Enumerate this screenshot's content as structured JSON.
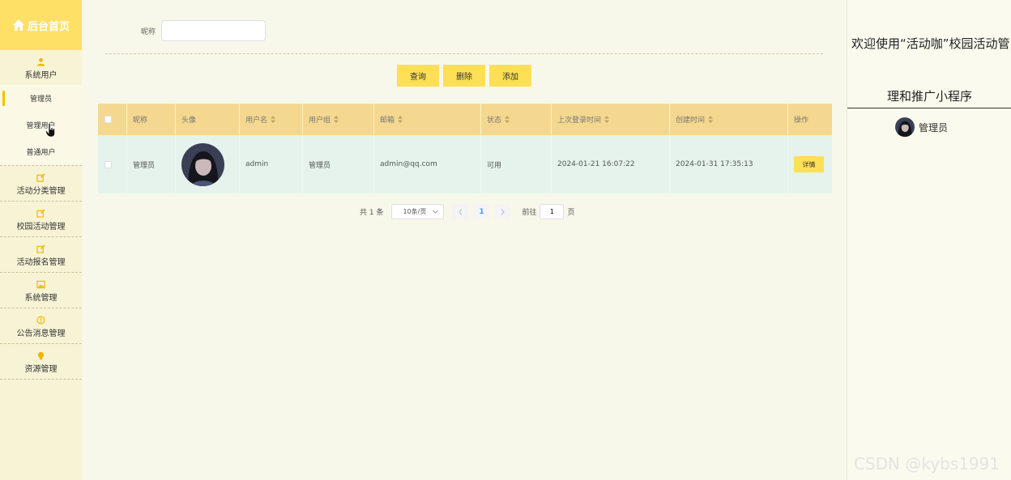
{
  "sidebar": {
    "logo": "后台首页",
    "groups": [
      {
        "label": "系统用户",
        "icon": "user-icon",
        "items": [
          "管理员",
          "管理用户",
          "普通用户"
        ]
      },
      {
        "label": "活动分类管理",
        "icon": "edit-icon"
      },
      {
        "label": "校园活动管理",
        "icon": "edit-icon"
      },
      {
        "label": "活动报名管理",
        "icon": "edit-icon"
      },
      {
        "label": "系统管理",
        "icon": "image-icon"
      },
      {
        "label": "公告消息管理",
        "icon": "info-icon"
      },
      {
        "label": "资源管理",
        "icon": "bulb-icon"
      }
    ],
    "active_item": "管理员"
  },
  "search": {
    "label": "昵称",
    "value": "",
    "placeholder": ""
  },
  "buttons": {
    "query": "查询",
    "delete": "删除",
    "add": "添加"
  },
  "table": {
    "headers": [
      "昵称",
      "头像",
      "用户名",
      "用户组",
      "邮箱",
      "状态",
      "上次登录时间",
      "创建时间",
      "操作"
    ],
    "rows": [
      {
        "nickname": "管理员",
        "username": "admin",
        "group": "管理员",
        "email": "admin@qq.com",
        "status": "可用",
        "last_login": "2024-01-21 16:07:22",
        "created": "2024-01-31 17:35:13",
        "action": "详情"
      }
    ]
  },
  "pagination": {
    "total": "共 1 条",
    "page_size": "10条/页",
    "current_page": "1",
    "goto_label": "前往",
    "goto_value": "1",
    "page_unit": "页"
  },
  "right_panel": {
    "welcome_line1": "欢迎使用“活动咖”校园活动管",
    "welcome_line2": "理和推广小程序",
    "user_name": "管理员"
  },
  "watermark": "CSDN @kybs1991",
  "colors": {
    "accent": "#ffdf56",
    "header": "#f5d88f",
    "row": "#e5f3ec",
    "sidebar": "#f7f4d6",
    "logo_bg": "#ffe066"
  }
}
